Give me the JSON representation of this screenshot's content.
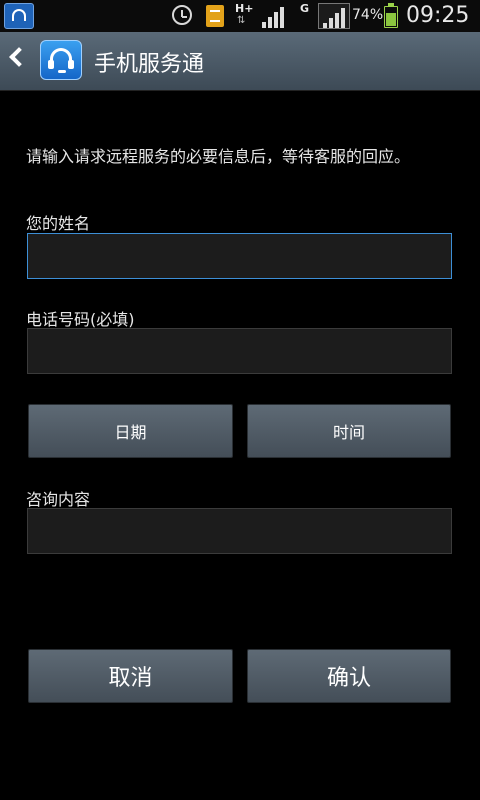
{
  "status_bar": {
    "time": "09:25",
    "battery_percent_text": "74%",
    "battery_level": 0.74,
    "network_type_1": "H+",
    "network_type_2": "G",
    "icons": [
      "app-notification-icon",
      "alarm-icon",
      "sim-card-icon",
      "signal-icon",
      "battery-icon"
    ]
  },
  "action_bar": {
    "title": "手机服务通",
    "logo_icon": "headset-icon",
    "back_icon": "chevron-left-icon"
  },
  "form": {
    "instructions": "请输入请求远程服务的必要信息后，等待客服的回应。",
    "name_label": "您的姓名",
    "name_value": "",
    "phone_label": "电话号码(必填)",
    "phone_value": "",
    "date_button": "日期",
    "time_button": "时间",
    "inquiry_label": "咨询内容",
    "inquiry_value": ""
  },
  "actions": {
    "cancel": "取消",
    "confirm": "确认"
  },
  "colors": {
    "background": "#000000",
    "action_bar": "#4a5865",
    "button": "#515c66",
    "focus_border": "#3d8fd6"
  }
}
